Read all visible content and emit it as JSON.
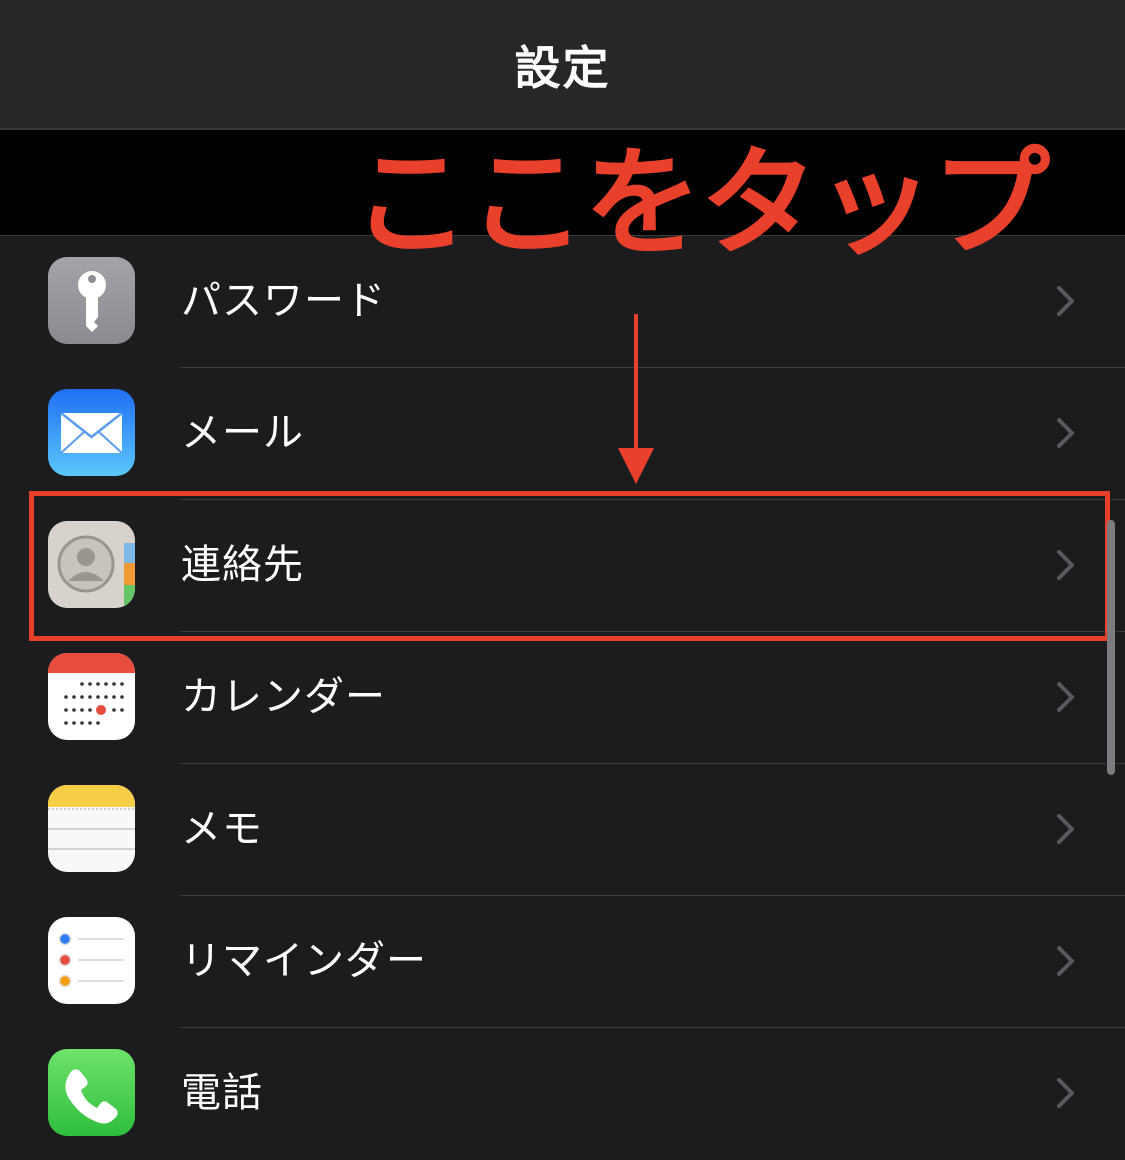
{
  "navbar": {
    "title": "設定"
  },
  "annotation": {
    "text": "ここをタップ",
    "color": "#e8402a"
  },
  "items": [
    {
      "label": "パスワード",
      "icon": "key-icon"
    },
    {
      "label": "メール",
      "icon": "mail-icon"
    },
    {
      "label": "連絡先",
      "icon": "contacts-icon",
      "highlighted": true
    },
    {
      "label": "カレンダー",
      "icon": "calendar-icon"
    },
    {
      "label": "メモ",
      "icon": "notes-icon"
    },
    {
      "label": "リマインダー",
      "icon": "reminders-icon"
    },
    {
      "label": "電話",
      "icon": "phone-icon"
    }
  ],
  "colors": {
    "background": "#1c1c1e",
    "navbar": "#272727",
    "chevron": "#5a5a5e",
    "annotation": "#e8402a"
  }
}
